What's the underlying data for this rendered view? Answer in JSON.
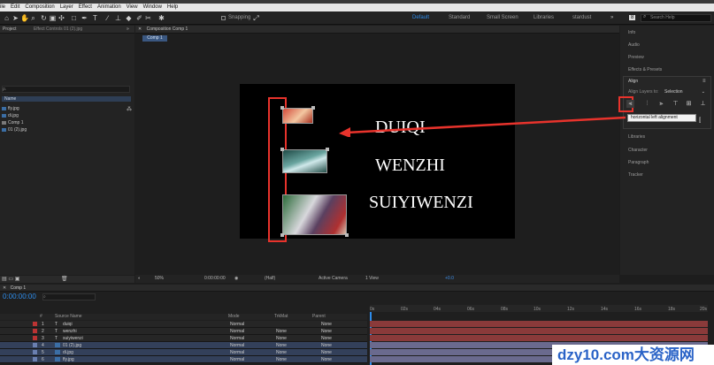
{
  "menubar": {
    "items": [
      "ile",
      "Edit",
      "Composition",
      "Layer",
      "Effect",
      "Animation",
      "View",
      "Window",
      "Help"
    ]
  },
  "toolbar": {
    "snapping": "Snapping",
    "workspaces": [
      "Default",
      "Standard",
      "Small Screen",
      "Libraries",
      "stardust"
    ],
    "active_workspace": "Default",
    "search_placeholder": "Search Help",
    "search_badge": "8"
  },
  "left_panel": {
    "tab_project": "Project",
    "tab_effect_controls": "Effect Controls 01 (2).jpg",
    "search_symbol": "ρ.",
    "column_name": "Name",
    "items": [
      "fly.jpg",
      "di.jpg",
      "Comp 1",
      "01 (2).jpg"
    ]
  },
  "composition": {
    "tab": "Composition Comp 1",
    "comp_tab": "Comp 1",
    "texts": [
      "DUIQI",
      "WENZHI",
      "SUIYIWENZI"
    ],
    "footer": {
      "zoom": "50%",
      "timecode": "0:00:00:00",
      "resolution": "(Half)",
      "camera": "Active Camera",
      "views": "1 View",
      "exposure": "+0.0"
    }
  },
  "right_panel": {
    "items": [
      "Info",
      "Audio",
      "Preview",
      "Effects & Presets"
    ],
    "align": {
      "title": "Align",
      "align_to_label": "Align Layers to:",
      "align_to_value": "Selection",
      "tooltip": "horizontal left alignment"
    },
    "items_below": [
      "Libraries",
      "Character",
      "Paragraph",
      "Tracker"
    ]
  },
  "timeline": {
    "tab": "Comp 1",
    "timecode": "0:00:00:00",
    "columns": {
      "num": "#",
      "source": "Source Name",
      "mode": "Mode",
      "trkmat": "TrkMat",
      "parent": "Parent"
    },
    "ruler": [
      "0s",
      "02s",
      "04s",
      "06s",
      "08s",
      "10s",
      "12s",
      "14s",
      "16s",
      "18s",
      "20s"
    ],
    "layers": [
      {
        "num": "1",
        "type": "T",
        "name": "duiqi",
        "mode": "Normal",
        "trkmat": "",
        "parent": "None"
      },
      {
        "num": "2",
        "type": "T",
        "name": "wenzhi",
        "mode": "Normal",
        "trkmat": "None",
        "parent": "None"
      },
      {
        "num": "3",
        "type": "T",
        "name": "suiyiwenzi",
        "mode": "Normal",
        "trkmat": "None",
        "parent": "None"
      },
      {
        "num": "4",
        "type": "img",
        "name": "01 (2).jpg",
        "mode": "Normal",
        "trkmat": "None",
        "parent": "None"
      },
      {
        "num": "5",
        "type": "img",
        "name": "di.jpg",
        "mode": "Normal",
        "trkmat": "None",
        "parent": "None"
      },
      {
        "num": "6",
        "type": "img",
        "name": "fly.jpg",
        "mode": "Normal",
        "trkmat": "None",
        "parent": "None"
      }
    ]
  },
  "watermark": "dzy10.com大资源网",
  "colors": {
    "accent": "#2d8ceb",
    "highlight_red": "#e8332c",
    "text_bar": "#8a3a3a",
    "image_bar": "#6a6a8e"
  }
}
